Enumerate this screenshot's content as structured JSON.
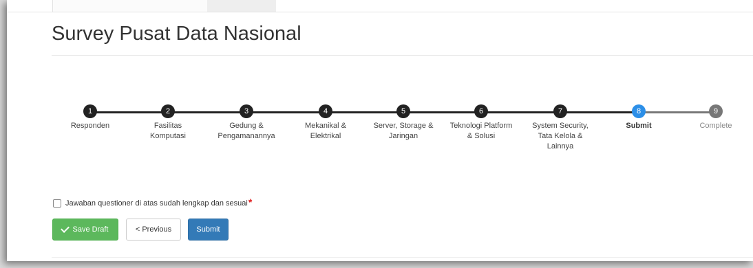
{
  "page": {
    "title": "Survey Pusat Data Nasional"
  },
  "wizard": {
    "steps": [
      {
        "number": "1",
        "label": "Responden"
      },
      {
        "number": "2",
        "label": "Fasilitas\nKomputasi"
      },
      {
        "number": "3",
        "label": "Gedung &\nPengamanannya"
      },
      {
        "number": "4",
        "label": "Mekanikal &\nElektrikal"
      },
      {
        "number": "5",
        "label": "Server, Storage &\nJaringan"
      },
      {
        "number": "6",
        "label": "Teknologi Platform\n& Solusi"
      },
      {
        "number": "7",
        "label": "System Security,\nTata Kelola &\nLainnya"
      },
      {
        "number": "8",
        "label": "Submit"
      },
      {
        "number": "9",
        "label": "Complete"
      }
    ],
    "active_step": 8,
    "colors": {
      "done": "#222222",
      "active": "#2c8fe8",
      "future": "#777777"
    }
  },
  "form": {
    "confirm_label": "Jawaban questioner di atas sudah lengkap dan sesuai",
    "confirm_checked": false,
    "required_mark": "*"
  },
  "buttons": {
    "save_draft": "Save Draft",
    "previous": "< Previous",
    "submit": "Submit"
  },
  "icons": {
    "save_draft": "check-icon"
  }
}
